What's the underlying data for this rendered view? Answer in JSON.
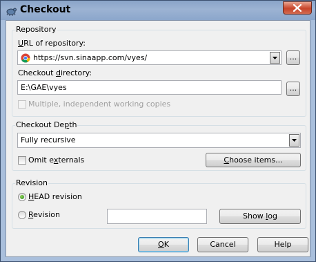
{
  "window": {
    "title": "Checkout",
    "icons": {
      "app": "tortoise-icon",
      "close": "close-icon"
    }
  },
  "repository": {
    "group_label": "Repository",
    "url_label": "URL of repository:",
    "url_value": "https://svn.sinaapp.com/vyes/",
    "url_icon": "chrome-icon",
    "browse_url_label": "...",
    "dir_label": "Checkout directory:",
    "dir_value": "E:\\GAE\\vyes",
    "browse_dir_label": "...",
    "multiple_label": "Multiple, independent working copies"
  },
  "depth": {
    "group_label": "Checkout Depth",
    "selected": "Fully recursive",
    "omit_label": "Omit externals",
    "choose_label": "Choose items..."
  },
  "revision": {
    "group_label": "Revision",
    "head_label": "HEAD revision",
    "rev_label": "Revision",
    "rev_value": "",
    "show_log_label": "Show log"
  },
  "buttons": {
    "ok": "OK",
    "cancel": "Cancel",
    "help": "Help"
  }
}
